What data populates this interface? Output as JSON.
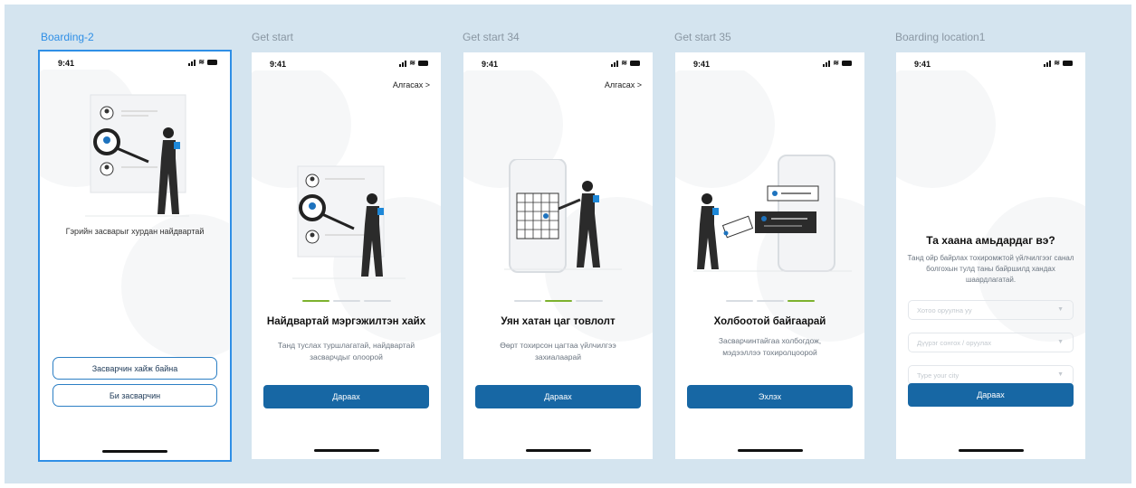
{
  "frames": [
    {
      "label": "Boarding-2",
      "selected": true
    },
    {
      "label": "Get start"
    },
    {
      "label": "Get start 34"
    },
    {
      "label": "Get start 35"
    },
    {
      "label": "Boarding location1"
    }
  ],
  "status": {
    "time": "9:41"
  },
  "skip_label": "Алгасах >",
  "boarding2": {
    "tagline": "Гэрийн засварыг хурдан найдвартай",
    "btn_find": "Засварчин хайж байна",
    "btn_iam": "Би засварчин"
  },
  "getstart": {
    "title": "Найдвартай мэргэжилтэн хайх",
    "subtitle": "Танд туслах туршлагатай, найдвартай засварчдыг олоорой",
    "button": "Дараах"
  },
  "getstart34": {
    "title": "Уян хатан цаг товлолт",
    "subtitle": "Өөрт тохирсон цагтаа үйлчилгээ захиалаарай",
    "button": "Дараах"
  },
  "getstart35": {
    "title": "Холбоотой байгаарай",
    "subtitle": "Засварчинтайгаа холбогдож, мэдээллээ тохиролцоорой",
    "button": "Эхлэх"
  },
  "location": {
    "title": "Та хаана амьдардаг вэ?",
    "subtitle": "Танд ойр байрлах тохиромжтой үйлчилгээг санал болгохын тулд таны байршилд хандах шаардлагатай.",
    "field1_placeholder": "Хотоо оруулна уу",
    "field2_placeholder": "Дүүрэг сонгох / оруулах",
    "field3_placeholder": "Type your city",
    "button": "Дараах"
  },
  "colors": {
    "primary": "#1767a4",
    "accent": "#2f8fe6",
    "progress": "#7db22e",
    "canvas": "#d4e4ef"
  }
}
